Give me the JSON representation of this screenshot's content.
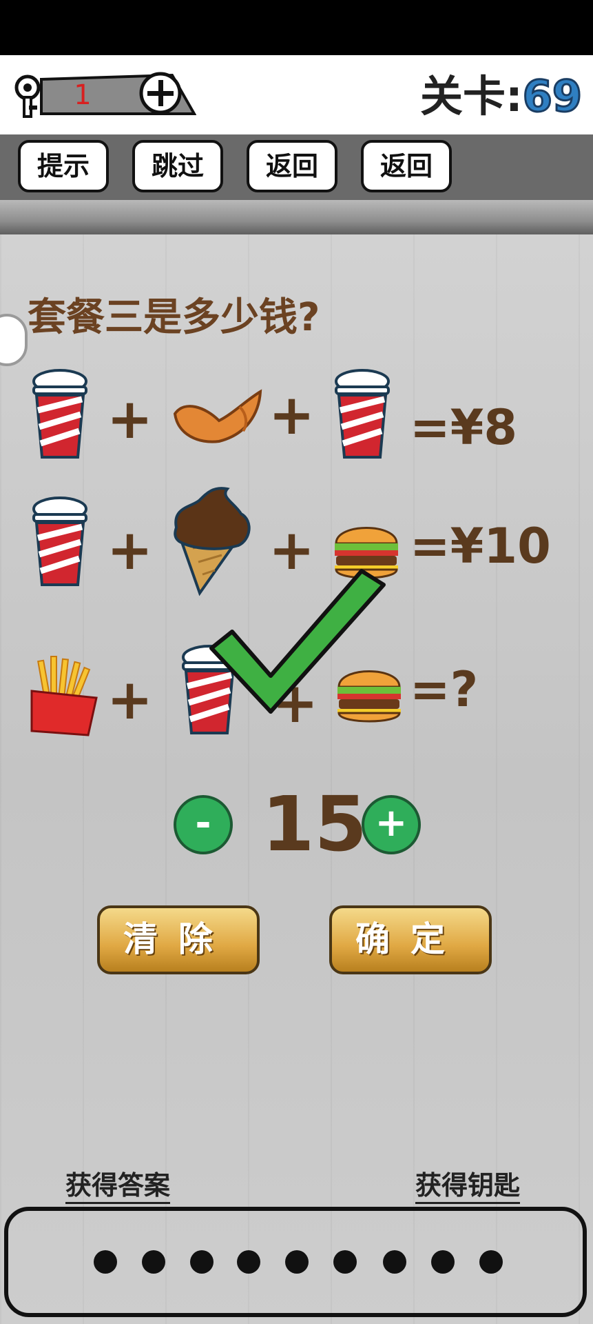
{
  "header": {
    "key_count": "1",
    "level_label": "关卡:",
    "level_number": "69"
  },
  "toolbar": {
    "hint": "提示",
    "skip": "跳过",
    "back1": "返回",
    "back2": "返回"
  },
  "puzzle": {
    "question": "套餐三是多少钱?",
    "row1_result": "=¥8",
    "row2_result": "=¥10",
    "row3_result": "=?",
    "plus": "+"
  },
  "answer": {
    "value": "15",
    "minus": "-",
    "plus": "+"
  },
  "actions": {
    "clear": "清除",
    "confirm": "确定"
  },
  "links": {
    "get_answer": "获得答案",
    "get_key": "获得钥匙"
  },
  "answer_dots": 9,
  "colors": {
    "level_number": "#2f7fc2",
    "round_button": "#2fae5a",
    "check": "#3fb043",
    "gold_button": "#e0a843"
  }
}
